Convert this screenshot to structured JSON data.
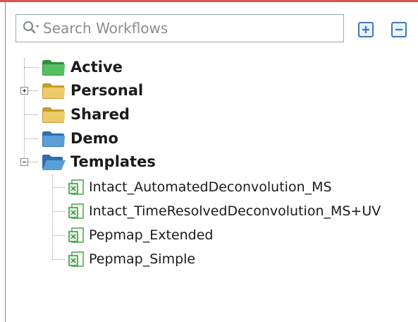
{
  "search": {
    "placeholder": "Search Workflows",
    "value": ""
  },
  "toolbar": {
    "expand_icon": "expand-all-icon",
    "collapse_icon": "collapse-all-icon"
  },
  "tree": {
    "folders": [
      {
        "label": "Active",
        "color": "#3fae49",
        "state": "leaf"
      },
      {
        "label": "Personal",
        "color": "#e0b84a",
        "state": "collapsed"
      },
      {
        "label": "Shared",
        "color": "#e0b84a",
        "state": "leaf"
      },
      {
        "label": "Demo",
        "color": "#3c85c6",
        "state": "leaf"
      },
      {
        "label": "Templates",
        "color": "#3c85c6",
        "state": "expanded",
        "children": [
          "Intact_AutomatedDeconvolution_MS",
          "Intact_TimeResolvedDeconvolution_MS+UV",
          "Pepmap_Extended",
          "Pepmap_Simple"
        ]
      }
    ]
  },
  "colors": {
    "accent": "#d9564a",
    "file_icon": "#4caf50"
  }
}
